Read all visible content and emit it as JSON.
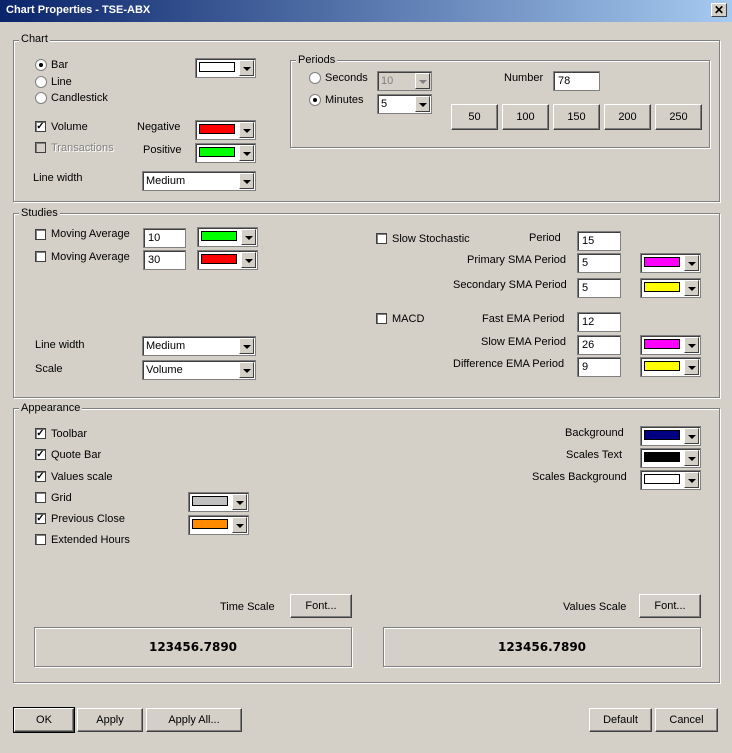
{
  "window": {
    "title": "Chart Properties - TSE-ABX",
    "close": "✕"
  },
  "chart": {
    "group_label": "Chart",
    "types": [
      {
        "label": "Bar",
        "selected": true
      },
      {
        "label": "Line",
        "selected": false
      },
      {
        "label": "Candlestick",
        "selected": false
      }
    ],
    "bar_color": "#ffffff",
    "volume": {
      "label": "Volume",
      "checked": true
    },
    "transactions": {
      "label": "Transactions",
      "checked": false,
      "disabled": true
    },
    "negative": {
      "label": "Negative",
      "color": "#ff0000"
    },
    "positive": {
      "label": "Positive",
      "color": "#00ff00"
    },
    "line_width": {
      "label": "Line width",
      "value": "Medium"
    },
    "periods": {
      "group_label": "Periods",
      "seconds": {
        "label": "Seconds",
        "selected": false,
        "value": "10",
        "disabled": true
      },
      "minutes": {
        "label": "Minutes",
        "selected": true,
        "value": "5"
      },
      "number": {
        "label": "Number",
        "value": "78"
      },
      "buttons": [
        "50",
        "100",
        "150",
        "200",
        "250"
      ]
    }
  },
  "studies": {
    "group_label": "Studies",
    "ma1": {
      "label": "Moving Average",
      "checked": false,
      "value": "10",
      "color": "#00ff00"
    },
    "ma2": {
      "label": "Moving Average",
      "checked": false,
      "value": "30",
      "color": "#ff0000"
    },
    "line_width": {
      "label": "Line width",
      "value": "Medium"
    },
    "scale": {
      "label": "Scale",
      "value": "Volume"
    },
    "slow_stochastic": {
      "label": "Slow Stochastic",
      "checked": false
    },
    "period": {
      "label": "Period",
      "value": "15"
    },
    "primary_sma": {
      "label": "Primary SMA Period",
      "value": "5",
      "color": "#ff00ff"
    },
    "secondary_sma": {
      "label": "Secondary SMA Period",
      "value": "5",
      "color": "#ffff00"
    },
    "macd": {
      "label": "MACD",
      "checked": false
    },
    "fast_ema": {
      "label": "Fast EMA Period",
      "value": "12"
    },
    "slow_ema": {
      "label": "Slow EMA Period",
      "value": "26",
      "color": "#ff00ff"
    },
    "diff_ema": {
      "label": "Difference EMA Period",
      "value": "9",
      "color": "#ffff00"
    }
  },
  "appearance": {
    "group_label": "Appearance",
    "toolbar": {
      "label": "Toolbar",
      "checked": true
    },
    "quote_bar": {
      "label": "Quote Bar",
      "checked": true
    },
    "values_scale": {
      "label": "Values scale",
      "checked": true
    },
    "grid": {
      "label": "Grid",
      "checked": false,
      "color": "#c0c0c0"
    },
    "previous_close": {
      "label": "Previous Close",
      "checked": true,
      "color": "#ff8c00"
    },
    "extended_hours": {
      "label": "Extended Hours",
      "checked": false
    },
    "background": {
      "label": "Background",
      "color": "#000080"
    },
    "scales_text": {
      "label": "Scales Text",
      "color": "#000000"
    },
    "scales_background": {
      "label": "Scales Background",
      "color": "#ffffff"
    },
    "time_scale": {
      "label": "Time Scale",
      "font_button": "Font...",
      "preview": "123456.7890"
    },
    "values_scale_font": {
      "label": "Values Scale",
      "font_button": "Font...",
      "preview": "123456.7890"
    }
  },
  "footer": {
    "ok": "OK",
    "apply": "Apply",
    "apply_all": "Apply All...",
    "default": "Default",
    "cancel": "Cancel"
  }
}
